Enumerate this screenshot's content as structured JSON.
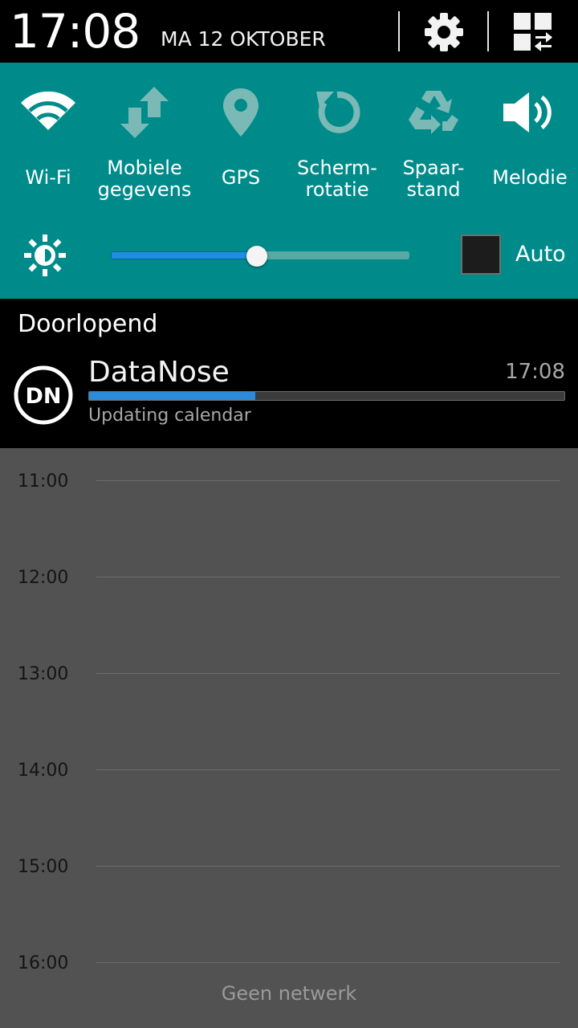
{
  "status_bar": {
    "time": "17:08",
    "date": "MA 12 OKTOBER",
    "settings_icon": "gear-icon",
    "edit_icon": "grid-edit-icon"
  },
  "quick_settings": {
    "toggles": [
      {
        "label": "Wi-Fi",
        "icon": "wifi-icon",
        "state": "on"
      },
      {
        "label": "Mobiele\ngegevens",
        "icon": "mobile-data-icon",
        "state": "off"
      },
      {
        "label": "GPS",
        "icon": "location-icon",
        "state": "off"
      },
      {
        "label": "Scherm-\nrotatie",
        "icon": "rotation-icon",
        "state": "off"
      },
      {
        "label": "Spaar-\nstand",
        "icon": "recycle-icon",
        "state": "off"
      },
      {
        "label": "Melodie",
        "icon": "speaker-icon",
        "state": "on"
      }
    ],
    "brightness": {
      "icon": "brightness-icon",
      "level": 0.49,
      "auto_label": "Auto",
      "auto_checked": false
    },
    "colors": {
      "panel": "#008b8b",
      "active_icon": "#ffffff",
      "inactive_icon": "#7ab9b6"
    }
  },
  "ongoing": {
    "header": "Doorlopend",
    "notification": {
      "app_name": "DataNose",
      "logo_text": "DN",
      "time": "17:08",
      "progress": 0.35,
      "text": "Updating calendar"
    }
  },
  "calendar": {
    "hours": [
      "11:00",
      "12:00",
      "13:00",
      "14:00",
      "15:00",
      "16:00"
    ]
  },
  "footer": {
    "no_network": "Geen netwerk"
  }
}
